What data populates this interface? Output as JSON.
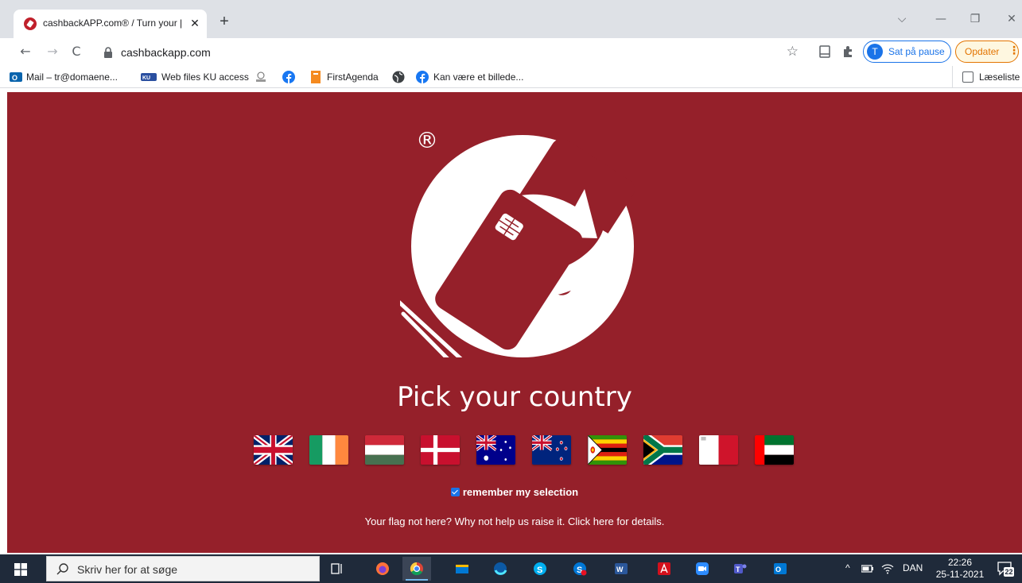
{
  "browser": {
    "tab": {
      "title": "cashbackAPP.com® / Turn your |",
      "close": "✕"
    },
    "new_tab": "+",
    "window_controls": {
      "dropdown": "⌵",
      "minimize": "—",
      "restore": "❐",
      "close": "✕"
    },
    "toolbar": {
      "back": "←",
      "forward": "→",
      "reload": "C",
      "url": "cashbackapp.com",
      "star": "☆",
      "profile_initial": "T",
      "profile_label": "Sat på pause",
      "update_label": "Opdater",
      "update_menu": "⋮"
    },
    "bookmarks": [
      {
        "label": "Mail – tr@domaene...",
        "icon": "outlook-icon"
      },
      {
        "label": "Web files KU access",
        "icon": "ku-icon"
      },
      {
        "label": "",
        "icon": "mobile-icon"
      },
      {
        "label": "",
        "icon": "facebook-icon"
      },
      {
        "label": "FirstAgenda",
        "icon": "firstagenda-icon"
      },
      {
        "label": "",
        "icon": "globe-icon"
      },
      {
        "label": "Kan være et billede...",
        "icon": "facebook-icon"
      }
    ],
    "reading_list": "Læseliste"
  },
  "page": {
    "registered_mark": "®",
    "headline": "Pick your country",
    "flags": [
      {
        "country": "United Kingdom"
      },
      {
        "country": "Ireland"
      },
      {
        "country": "Hungary"
      },
      {
        "country": "Denmark"
      },
      {
        "country": "Australia"
      },
      {
        "country": "New Zealand"
      },
      {
        "country": "Zimbabwe"
      },
      {
        "country": "South Africa"
      },
      {
        "country": "Malta"
      },
      {
        "country": "United Arab Emirates"
      }
    ],
    "remember_label": "remember my selection",
    "remember_checked": true,
    "flag_note": "Your flag not here? Why not help us raise it. Click here for details.",
    "colors": {
      "background": "#95202a",
      "text": "#ffffff"
    }
  },
  "taskbar": {
    "search_placeholder": "Skriv her for at søge",
    "apps": [
      "task-view",
      "firefox",
      "chrome",
      "file-explorer",
      "edge",
      "skype",
      "skype-for-business",
      "word",
      "acrobat",
      "zoom",
      "teams",
      "outlook"
    ],
    "tray": {
      "chevron": "^",
      "language": "DAN"
    },
    "time": "22:26",
    "date": "25-11-2021",
    "notification_count": "22"
  }
}
